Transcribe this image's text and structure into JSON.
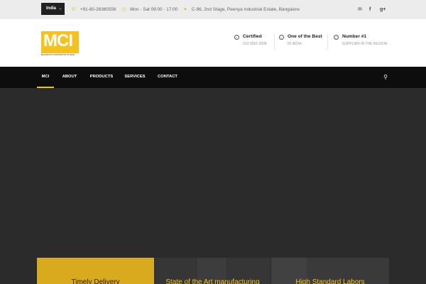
{
  "topbar": {
    "country_label": "India",
    "phone": "+91-80-28360556",
    "hours": "Mon - Sat 09:00 - 17:00",
    "address": "C-96, 2nd Stage, Peenya Industrial Estate, Bangalore",
    "social_icons": [
      "envelope-icon",
      "facebook-icon",
      "google-plus-icon"
    ]
  },
  "logo": {
    "text": "MCI",
    "subtitle": "MAGNETICS CORPORATION OF INDIA"
  },
  "badges": [
    {
      "title": "Certified",
      "subtitle": "ISO 9001:2008"
    },
    {
      "title": "One of the Best",
      "subtitle": "IN INDIA"
    },
    {
      "title": "Number #1",
      "subtitle": "SUPPLIER IN THE REGION"
    }
  ],
  "nav": {
    "items": [
      {
        "label": "MCI"
      },
      {
        "label": "ABOUT"
      },
      {
        "label": "PRODUCTS"
      },
      {
        "label": "SERVICES"
      },
      {
        "label": "CONTACT"
      }
    ]
  },
  "features": [
    {
      "title": "Timely Delivery"
    },
    {
      "title": "State of the Art manufacturing"
    },
    {
      "title": "High Standard Labors"
    }
  ],
  "colors": {
    "accent": "#f4c21b",
    "nav_bg": "#0d0d0d",
    "hero_bg": "#2b2b2b"
  }
}
